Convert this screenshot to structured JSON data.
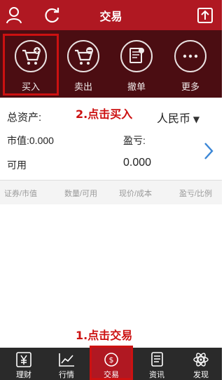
{
  "header": {
    "title": "交易"
  },
  "toolbar": {
    "items": [
      {
        "label": "买入",
        "icon": "buy-cart-icon"
      },
      {
        "label": "卖出",
        "icon": "sell-cart-icon"
      },
      {
        "label": "撤单",
        "icon": "cancel-order-icon"
      },
      {
        "label": "更多",
        "icon": "more-icon"
      }
    ]
  },
  "annotations": {
    "step2": "2.点击买入",
    "step1": "1.点击交易"
  },
  "assets": {
    "total_label": "总资产:",
    "currency": "人民币",
    "market_value": "市值:0.000",
    "profit_label": "盈亏:",
    "available_label": "可用",
    "available_value": "0.000"
  },
  "table": {
    "columns": [
      "证券/市值",
      "数量/可用",
      "现价/成本",
      "盈亏/比例"
    ]
  },
  "tabbar": {
    "items": [
      {
        "label": "理财",
        "icon": "yen-icon"
      },
      {
        "label": "行情",
        "icon": "chart-icon"
      },
      {
        "label": "交易",
        "icon": "trade-icon"
      },
      {
        "label": "资讯",
        "icon": "news-icon"
      },
      {
        "label": "发现",
        "icon": "atom-icon"
      }
    ]
  },
  "colors": {
    "header": "#b01822",
    "toolbar": "#4b0d12",
    "annotation": "#cc1111",
    "tabbar": "#2a2a2a",
    "active_tab": "#b01822"
  }
}
